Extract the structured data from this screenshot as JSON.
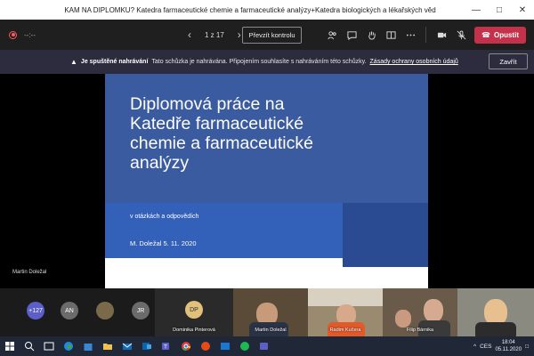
{
  "window": {
    "title": "KAM NA DIPLOMKU? Katedra farmaceutické chemie a farmaceutické analýzy+Katedra biologických a lékařských věd"
  },
  "toolbar": {
    "timer": "--:--",
    "page_count": "1 z 17",
    "take_control_label": "Převzít kontrolu",
    "leave_label": "Opustit"
  },
  "banner": {
    "title": "Je spuštěné nahrávání",
    "text": "Tato schůzka je nahrávána. Připojením souhlasíte s nahráváním této schůzky.",
    "link": "Zásady ochrany osobních údajů",
    "close_label": "Zavřít"
  },
  "presenter": {
    "name": "Martin Doležal"
  },
  "slide": {
    "title_line1": "Diplomová práce na",
    "title_line2": "Katedře farmaceutické",
    "title_line3": "chemie a farmaceutické",
    "title_line4": "analýzy",
    "subtitle": "v otázkách a odpovědích",
    "meta": "M. Doležal 5. 11. 2020"
  },
  "participants": {
    "overflow": "+127",
    "bubbles": [
      "AN",
      "JR"
    ],
    "tiles": [
      {
        "initials": "DP",
        "name": "Dominika Pinterová"
      },
      {
        "name": "Martin Doležal"
      },
      {
        "name": "Radim Kučera"
      },
      {
        "name": "Filip Bárnika"
      },
      {
        "name": ""
      }
    ]
  },
  "taskbar": {
    "lang": "CES",
    "time": "18:04",
    "date": "05.11.2020"
  },
  "colors": {
    "leave": "#c4314b",
    "banner_bg": "#2d2c3f",
    "slide_blue": "#3a5b9f"
  }
}
